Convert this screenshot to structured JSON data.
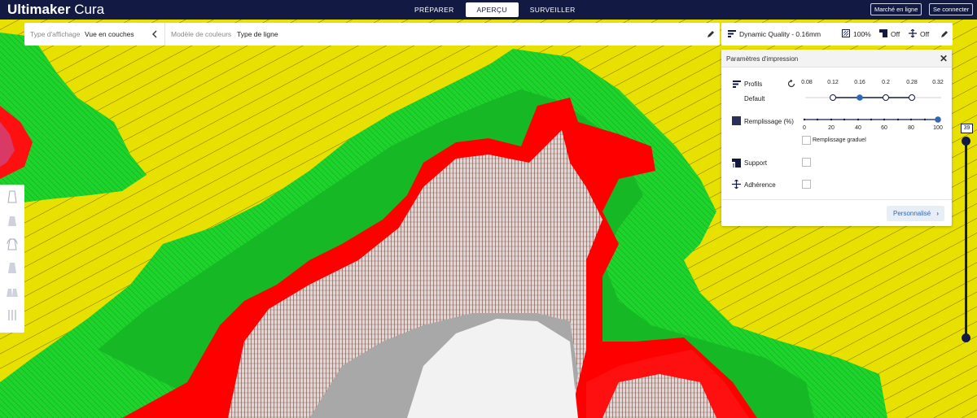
{
  "app": {
    "brand_bold": "Ultimaker",
    "brand_light": " Cura"
  },
  "stages": [
    {
      "label": "PRÉPARER",
      "active": false
    },
    {
      "label": "APERÇU",
      "active": true
    },
    {
      "label": "SURVEILLER",
      "active": false
    }
  ],
  "topbar": {
    "marketplace": "Marché en ligne",
    "signin": "Se connecter"
  },
  "viewbar": {
    "view_type_label": "Type d'affichage",
    "view_type_value": "Vue en couches",
    "color_scheme_label": "Modèle de couleurs",
    "color_scheme_value": "Type de ligne"
  },
  "printbar": {
    "profile": "Dynamic Quality - 0.16mm",
    "infill": "100%",
    "support": "Off",
    "adhesion": "Off"
  },
  "panel": {
    "title": "Paramètres d'impression",
    "profiles_label": "Profils",
    "default_label": "Default",
    "profile_ticks": [
      "0.08",
      "0.12",
      "0.16",
      "0.2",
      "0.28",
      "0.32"
    ],
    "profile_selected": "0.16",
    "infill_label": "Remplissage (%)",
    "infill_ticks": [
      "0",
      "20",
      "40",
      "60",
      "80",
      "100"
    ],
    "infill_value": 100,
    "gradual_label": "Remplissage graduel",
    "support_label": "Support",
    "adhesion_label": "Adhérence",
    "custom_button": "Personnalisé"
  },
  "layer_slider": {
    "current_layer": "39"
  },
  "colors": {
    "topbar": "#121a43",
    "accent_blue": "#2d67b7",
    "skin_yellow": "#e8e000",
    "wall_inner_green": "#1bd12b",
    "wall_outer_red": "#ff0000",
    "infill_red": "#b52020",
    "build_plate": "#f2f2f2"
  }
}
